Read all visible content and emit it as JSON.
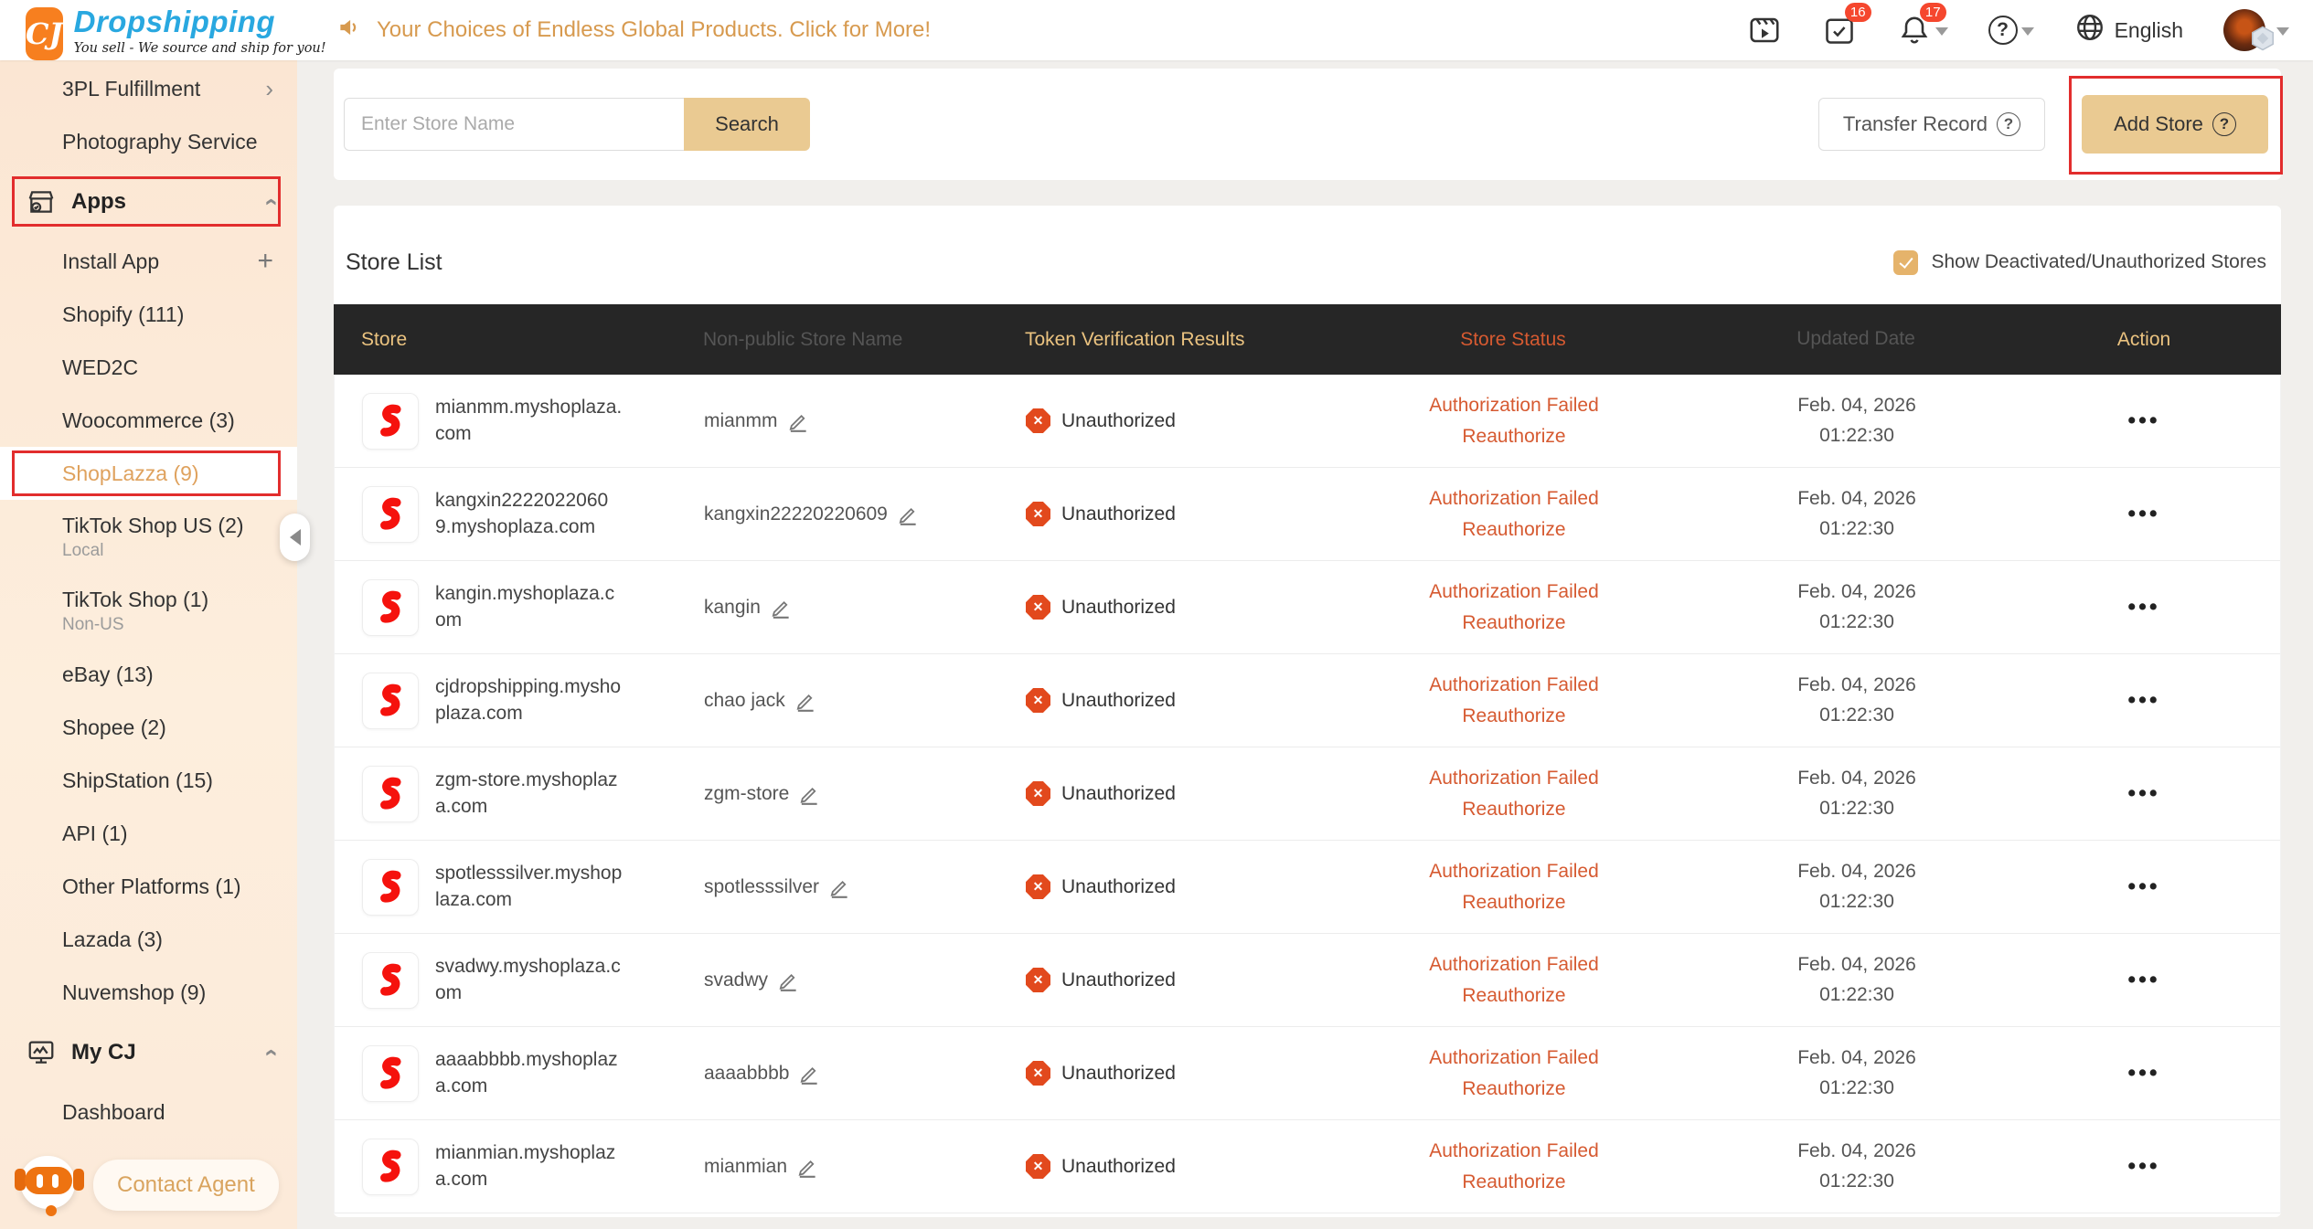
{
  "header": {
    "logo": {
      "square_text": "CJ",
      "brand": "Dropshipping",
      "tagline": "You sell - We source and ship for you!"
    },
    "announcement": "Your Choices of Endless Global Products. Click for More!",
    "badges": {
      "tasks": "16",
      "notifications": "17"
    },
    "help_glyph": "?",
    "language": "English"
  },
  "sidebar": {
    "items": [
      {
        "label": "3PL Fulfillment",
        "type": "item",
        "trailing": "chevron-right"
      },
      {
        "label": "Photography Service",
        "type": "item"
      },
      {
        "label": "Apps",
        "type": "section",
        "icon": "storefront-icon",
        "trailing": "chevron-up",
        "annotated": true
      },
      {
        "label": "Install App",
        "type": "item",
        "trailing": "plus"
      },
      {
        "label": "Shopify (111)",
        "type": "item"
      },
      {
        "label": "WED2C",
        "type": "item"
      },
      {
        "label": "Woocommerce (3)",
        "type": "item"
      },
      {
        "label": "ShopLazza (9)",
        "type": "item",
        "active": true,
        "annotated": true
      },
      {
        "label": "TikTok Shop US (2)",
        "sublabel": "Local",
        "type": "item"
      },
      {
        "label": "TikTok Shop (1)",
        "sublabel": "Non-US",
        "type": "item"
      },
      {
        "label": "eBay (13)",
        "type": "item"
      },
      {
        "label": "Shopee (2)",
        "type": "item"
      },
      {
        "label": "ShipStation (15)",
        "type": "item"
      },
      {
        "label": "API (1)",
        "type": "item"
      },
      {
        "label": "Other Platforms (1)",
        "type": "item"
      },
      {
        "label": "Lazada (3)",
        "type": "item"
      },
      {
        "label": "Nuvemshop (9)",
        "type": "item"
      },
      {
        "label": "My CJ",
        "type": "section",
        "icon": "dashboard-monitor-icon",
        "trailing": "chevron-up"
      },
      {
        "label": "Dashboard",
        "type": "item"
      }
    ],
    "contact_agent": "Contact Agent"
  },
  "toolbar": {
    "search_placeholder": "Enter Store Name",
    "search_label": "Search",
    "transfer_record_label": "Transfer Record",
    "add_store_label": "Add Store",
    "help_glyph": "?"
  },
  "store_list": {
    "title": "Store List",
    "show_deactivated_label": "Show Deactivated/Unauthorized Stores",
    "checkbox_checked": true,
    "columns": [
      "Store",
      "Non-public Store Name",
      "Token Verification Results",
      "Store Status",
      "Updated Date",
      "Action"
    ],
    "shared": {
      "token_status": "Unauthorized",
      "status_line1": "Authorization Failed",
      "status_line2": "Reauthorize",
      "date_line1": "Feb. 04, 2026",
      "date_line2": "01:22:30",
      "action": "•••"
    },
    "rows": [
      {
        "store": "mianmm.myshoplaza.com",
        "name": "mianmm"
      },
      {
        "store": "kangxin22220220609.myshoplaza.com",
        "name": "kangxin22220220609"
      },
      {
        "store": "kangin.myshoplaza.com",
        "name": "kangin"
      },
      {
        "store": "cjdropshipping.myshoplaza.com",
        "name": "chao jack"
      },
      {
        "store": "zgm-store.myshoplaza.com",
        "name": "zgm-store"
      },
      {
        "store": "spotlesssilver.myshoplaza.com",
        "name": "spotlesssilver"
      },
      {
        "store": "svadwy.myshoplaza.com",
        "name": "svadwy"
      },
      {
        "store": "aaaabbbb.myshoplaza.com",
        "name": "aaaabbbb"
      },
      {
        "store": "mianmian.myshoplaza.com",
        "name": "mianmian"
      }
    ]
  },
  "colors": {
    "accent_tan": "#EACA92",
    "annotation_red": "#E22D2D",
    "status_red": "#D65A31",
    "thead_bg": "#262626",
    "thead_text": "#EBC380",
    "active_item_text": "#DFA25E",
    "unauthorized_icon": "#E2491D",
    "announcement_text": "#D79A4F",
    "brand_blue": "#29A8E0",
    "logo_orange": "#F77F1F",
    "badge_red": "#F5472E",
    "sidebar_bg": "#FBE8D7",
    "page_bg": "#F1EFEC"
  }
}
